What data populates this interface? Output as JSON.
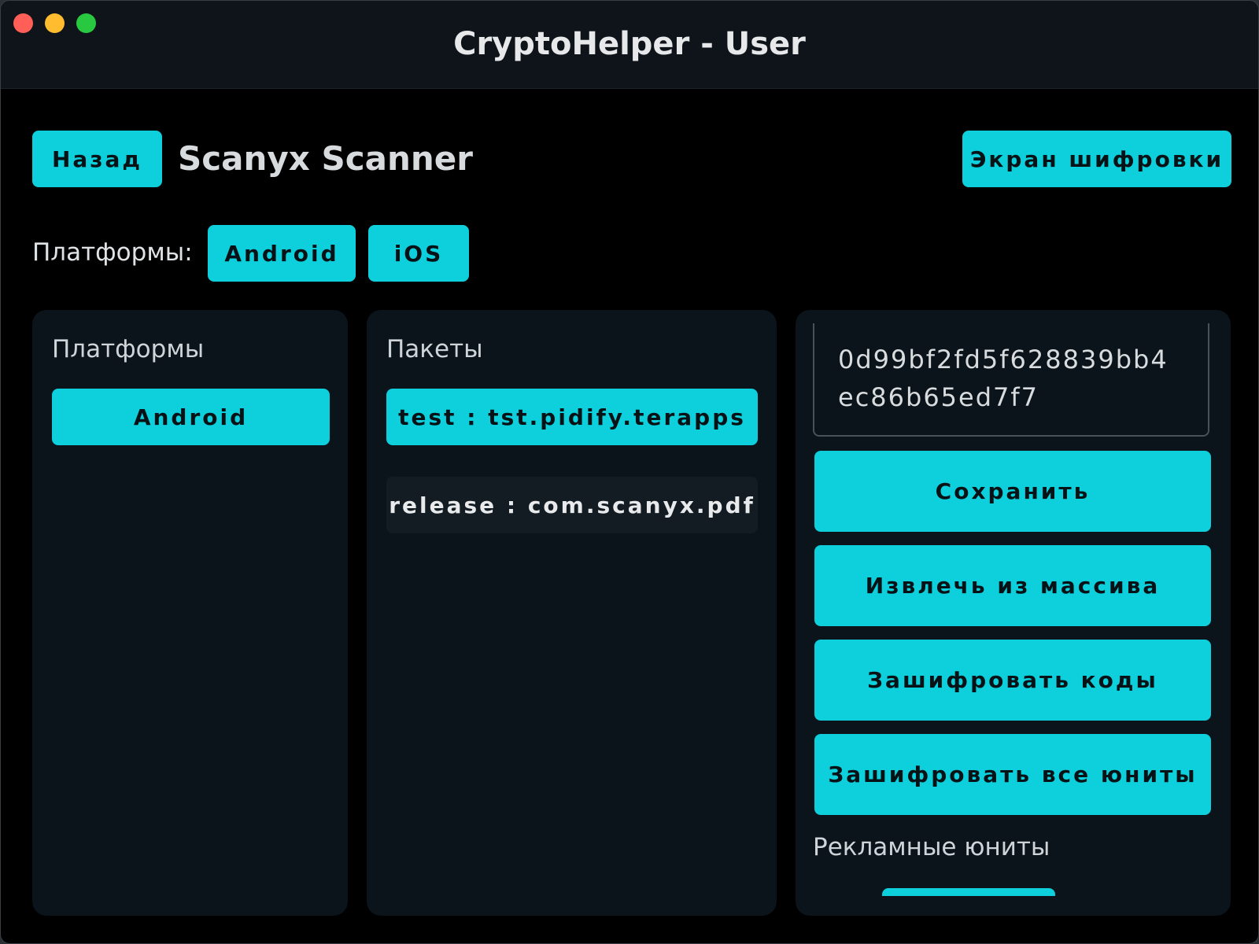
{
  "window": {
    "title": "CryptoHelper - User"
  },
  "header": {
    "back_label": "Назад",
    "screen_title": "Scanyx Scanner",
    "encrypt_screen_label": "Экран шифровки"
  },
  "platform_bar": {
    "label": "Платформы:",
    "options": [
      "Android",
      "iOS"
    ]
  },
  "platforms_panel": {
    "heading": "Платформы",
    "items": [
      "Android"
    ],
    "selected": "Android"
  },
  "packages_panel": {
    "heading": "Пакеты",
    "items": [
      {
        "label": "test : tst.pidify.terapps",
        "selected": true
      },
      {
        "label": "release : com.scanyx.pdf",
        "selected": false
      }
    ]
  },
  "actions_panel": {
    "hash_value": "0d99bf2fd5f628839bb4ec86b65ed7f7",
    "save_label": "Сохранить",
    "extract_label": "Извлечь из массива",
    "encrypt_codes_label": "Зашифровать коды",
    "encrypt_all_units_label": "Зашифровать все юниты",
    "ad_units_heading": "Рекламные юниты"
  },
  "colors": {
    "accent": "#0dd0dc",
    "background": "#000000",
    "panel": "#0b141a",
    "titlebar": "#0e141a"
  }
}
